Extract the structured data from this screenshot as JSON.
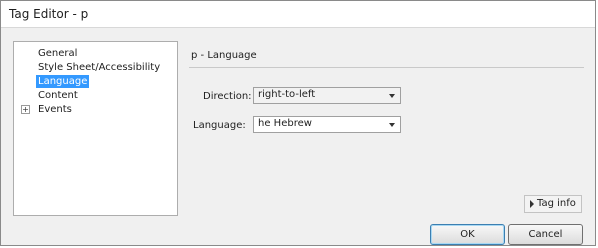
{
  "window": {
    "title": "Tag Editor - p"
  },
  "sidebar": {
    "items": [
      {
        "label": "General",
        "selected": false
      },
      {
        "label": "Style Sheet/Accessibility",
        "selected": false
      },
      {
        "label": "Language",
        "selected": true
      },
      {
        "label": "Content",
        "selected": false
      },
      {
        "label": "Events",
        "selected": false,
        "expandable": true,
        "expander_symbol": "+"
      }
    ]
  },
  "panel": {
    "title": "p - Language",
    "direction": {
      "label": "Direction:",
      "value": "right-to-left"
    },
    "language": {
      "label": "Language:",
      "value": "he Hebrew"
    }
  },
  "footer": {
    "tag_info_label": "Tag info",
    "ok_label": "OK",
    "cancel_label": "Cancel"
  },
  "colors": {
    "selection": "#3399ff",
    "window_bg": "#f0f0f0"
  }
}
